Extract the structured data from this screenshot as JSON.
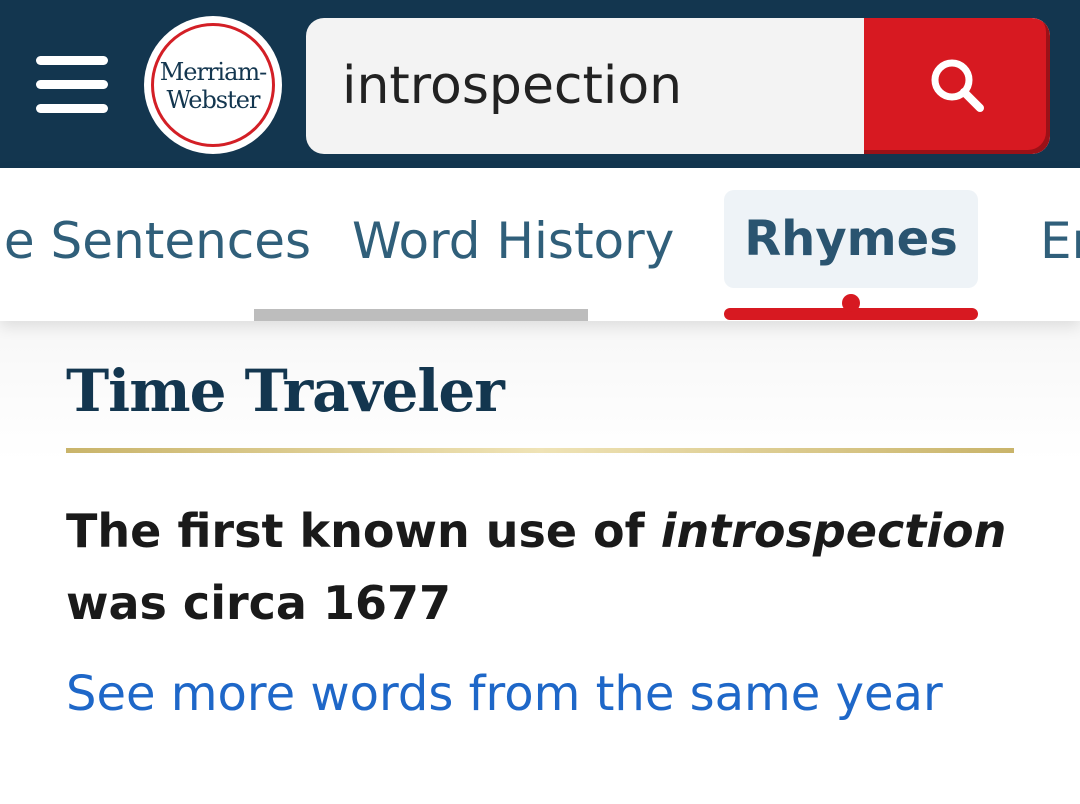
{
  "header": {
    "logo_line1": "Merriam-",
    "logo_line2": "Webster",
    "search_value": "introspection"
  },
  "tabs": [
    {
      "label": "le Sentences"
    },
    {
      "label": "Word History"
    },
    {
      "label": "Rhymes",
      "active": true
    },
    {
      "label": "Er"
    }
  ],
  "time_traveler": {
    "title": "Time Traveler",
    "first_use_prefix": "The first known use of ",
    "word": "introspection",
    "first_use_suffix": " was circa 1677",
    "link_text": "See more words from the same year"
  },
  "colors": {
    "header_bg": "#13364f",
    "search_button": "#d71921",
    "active_underline": "#d71921",
    "link": "#1e67c8",
    "rule_gold": "#c9b46a"
  },
  "icons": [
    "menu-icon",
    "search-icon"
  ]
}
